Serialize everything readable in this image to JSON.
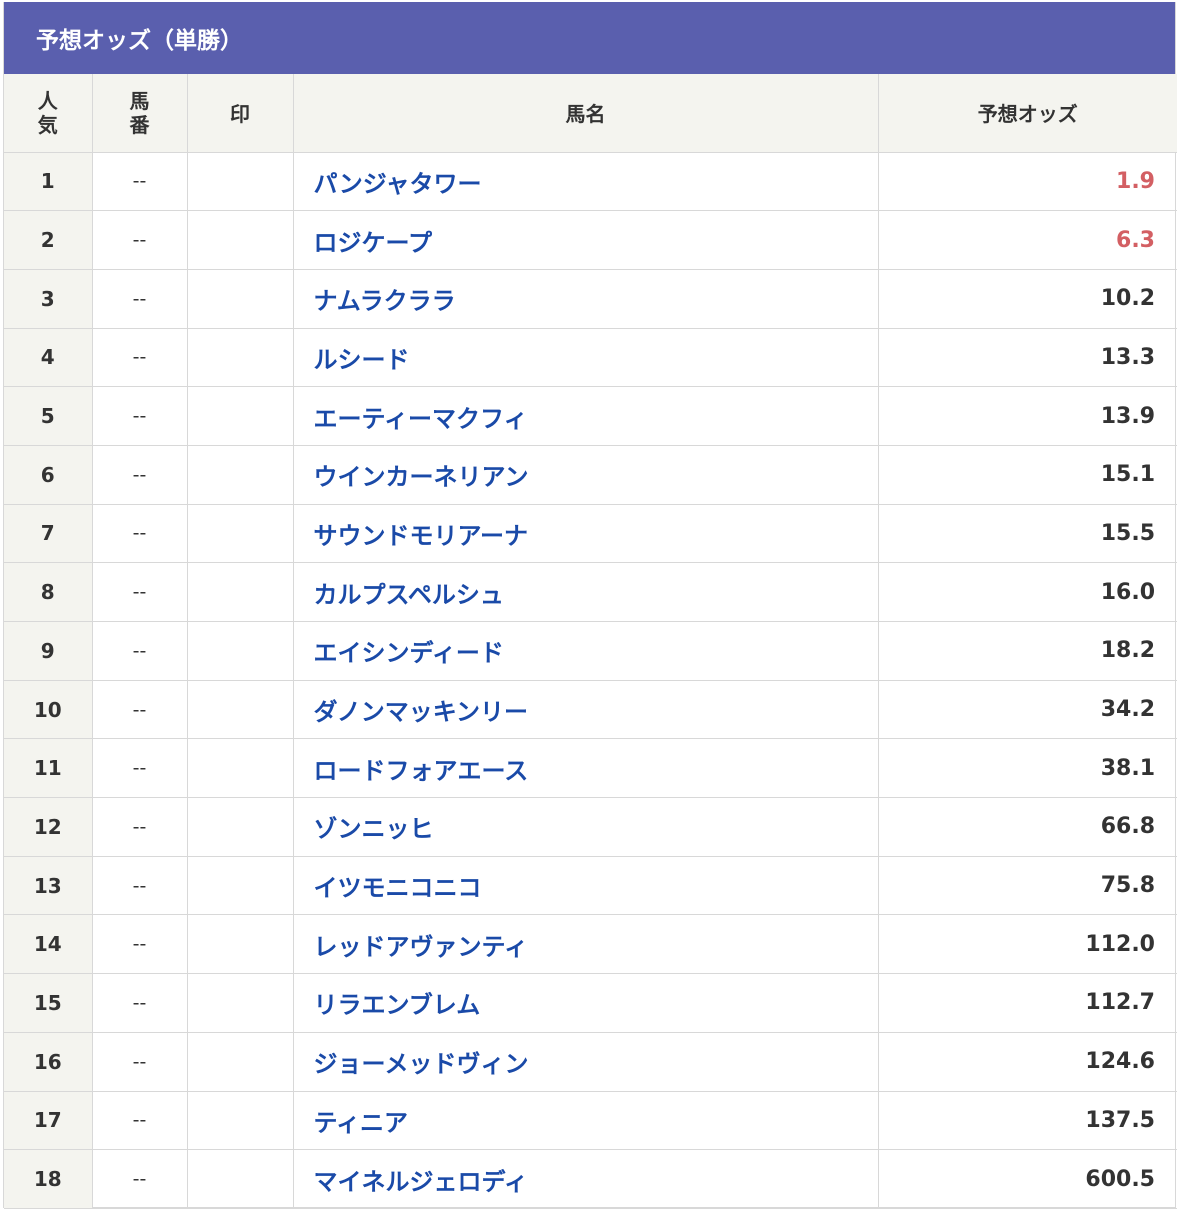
{
  "panel": {
    "title": "予想オッズ（単勝）"
  },
  "columns": {
    "popularity": [
      "人",
      "気"
    ],
    "horse_number": [
      "馬",
      "番"
    ],
    "mark": "印",
    "horse_name": "馬名",
    "odds": "予想オッズ"
  },
  "colors": {
    "header_bg": "#5a5fae",
    "name_link": "#1a4aa8",
    "hot_odds": "#d35f63",
    "normal_odds": "#333333"
  },
  "rows": [
    {
      "rank": "1",
      "number": "--",
      "mark": "",
      "name": "パンジャタワー",
      "odds": "1.9",
      "hot": true
    },
    {
      "rank": "2",
      "number": "--",
      "mark": "",
      "name": "ロジケープ",
      "odds": "6.3",
      "hot": true
    },
    {
      "rank": "3",
      "number": "--",
      "mark": "",
      "name": "ナムラクララ",
      "odds": "10.2",
      "hot": false
    },
    {
      "rank": "4",
      "number": "--",
      "mark": "",
      "name": "ルシード",
      "odds": "13.3",
      "hot": false
    },
    {
      "rank": "5",
      "number": "--",
      "mark": "",
      "name": "エーティーマクフィ",
      "odds": "13.9",
      "hot": false
    },
    {
      "rank": "6",
      "number": "--",
      "mark": "",
      "name": "ウインカーネリアン",
      "odds": "15.1",
      "hot": false
    },
    {
      "rank": "7",
      "number": "--",
      "mark": "",
      "name": "サウンドモリアーナ",
      "odds": "15.5",
      "hot": false
    },
    {
      "rank": "8",
      "number": "--",
      "mark": "",
      "name": "カルプスペルシュ",
      "odds": "16.0",
      "hot": false
    },
    {
      "rank": "9",
      "number": "--",
      "mark": "",
      "name": "エイシンディード",
      "odds": "18.2",
      "hot": false
    },
    {
      "rank": "10",
      "number": "--",
      "mark": "",
      "name": "ダノンマッキンリー",
      "odds": "34.2",
      "hot": false
    },
    {
      "rank": "11",
      "number": "--",
      "mark": "",
      "name": "ロードフォアエース",
      "odds": "38.1",
      "hot": false
    },
    {
      "rank": "12",
      "number": "--",
      "mark": "",
      "name": "ゾンニッヒ",
      "odds": "66.8",
      "hot": false
    },
    {
      "rank": "13",
      "number": "--",
      "mark": "",
      "name": "イツモニコニコ",
      "odds": "75.8",
      "hot": false
    },
    {
      "rank": "14",
      "number": "--",
      "mark": "",
      "name": "レッドアヴァンティ",
      "odds": "112.0",
      "hot": false
    },
    {
      "rank": "15",
      "number": "--",
      "mark": "",
      "name": "リラエンブレム",
      "odds": "112.7",
      "hot": false
    },
    {
      "rank": "16",
      "number": "--",
      "mark": "",
      "name": "ジョーメッドヴィン",
      "odds": "124.6",
      "hot": false
    },
    {
      "rank": "17",
      "number": "--",
      "mark": "",
      "name": "ティニア",
      "odds": "137.5",
      "hot": false
    },
    {
      "rank": "18",
      "number": "--",
      "mark": "",
      "name": "マイネルジェロディ",
      "odds": "600.5",
      "hot": false
    }
  ]
}
